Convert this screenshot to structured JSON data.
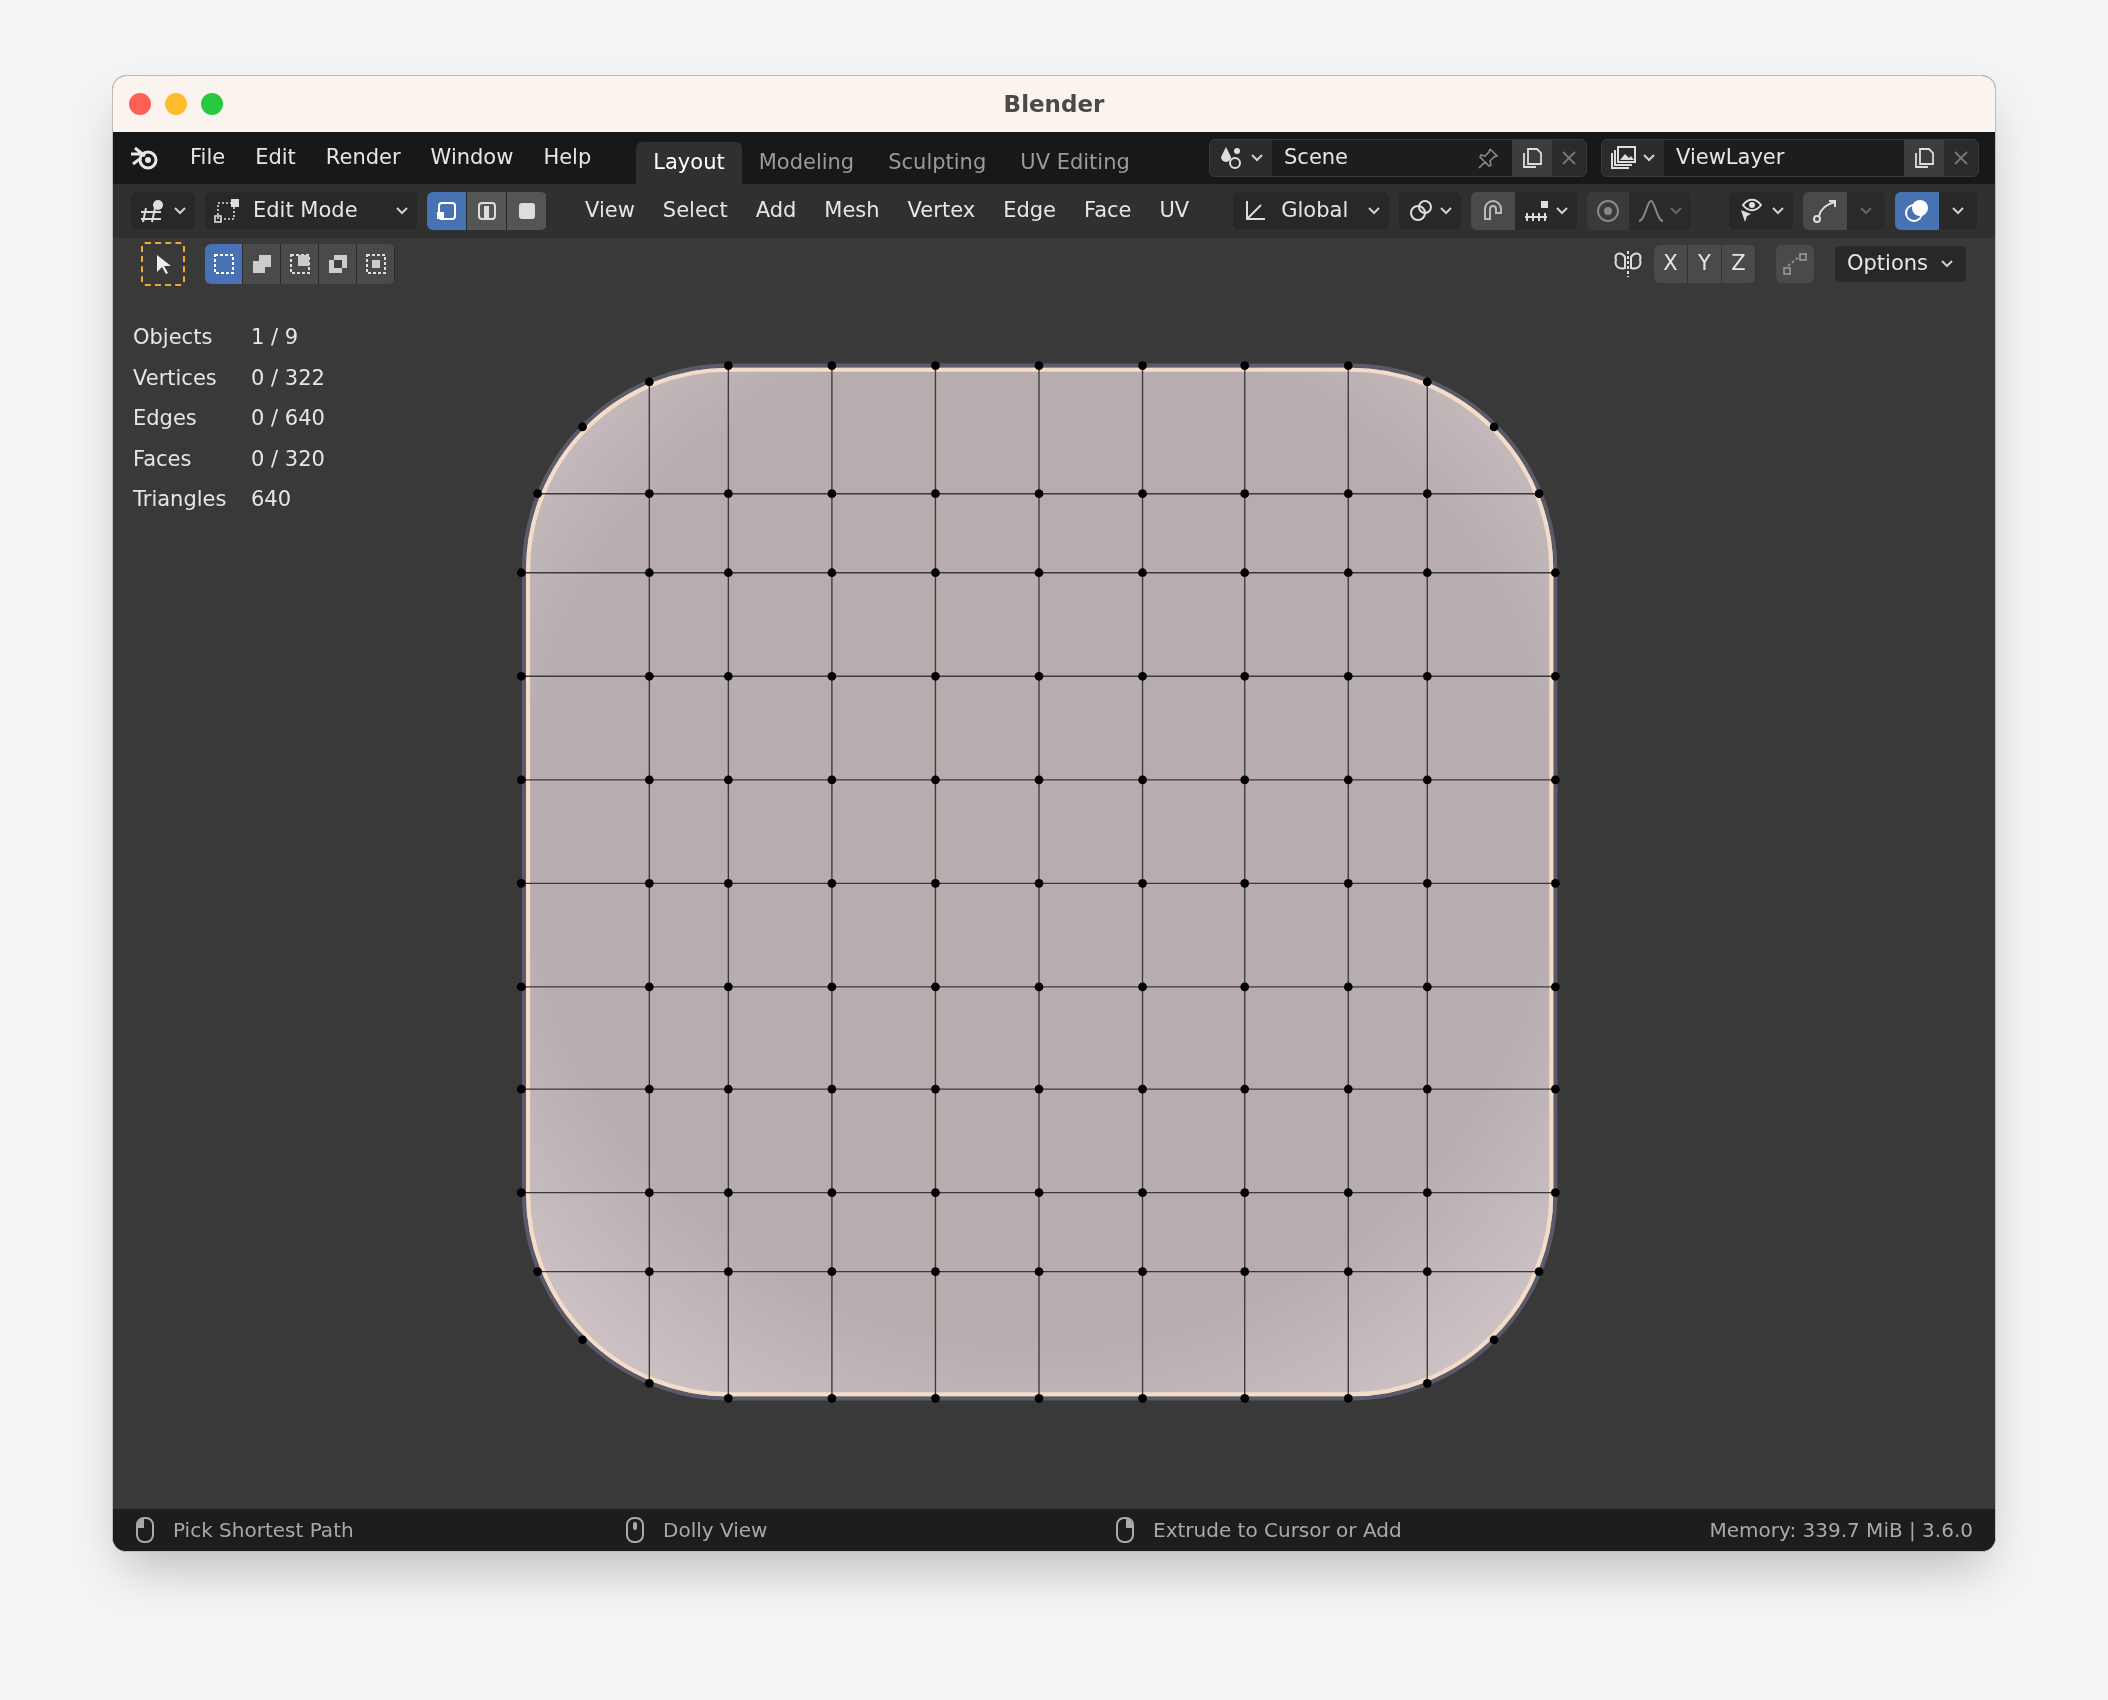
{
  "window": {
    "title": "Blender"
  },
  "menu": [
    "File",
    "Edit",
    "Render",
    "Window",
    "Help"
  ],
  "workspaces": [
    {
      "label": "Layout",
      "selected": true
    },
    {
      "label": "Modeling",
      "selected": false
    },
    {
      "label": "Sculpting",
      "selected": false
    },
    {
      "label": "UV Editing",
      "selected": false
    }
  ],
  "scene": {
    "value": "Scene"
  },
  "view_layer": {
    "value": "ViewLayer"
  },
  "header": {
    "mode": "Edit Mode",
    "select_modes": [
      {
        "kind": "vertex",
        "selected": true
      },
      {
        "kind": "edge",
        "selected": false
      },
      {
        "kind": "face",
        "selected": false
      }
    ],
    "menus": [
      "View",
      "Select",
      "Add",
      "Mesh",
      "Vertex",
      "Edge",
      "Face",
      "UV"
    ],
    "orientation": "Global",
    "snap": {
      "on": false
    },
    "proportional": {
      "on": false
    },
    "xray": {
      "on": true
    }
  },
  "tool_row": {
    "select_tool": {
      "selected": true
    },
    "box_modes": [
      {
        "kind": "new",
        "selected": true
      },
      {
        "kind": "extend",
        "selected": false
      },
      {
        "kind": "subtract",
        "selected": false
      },
      {
        "kind": "invert",
        "selected": false
      },
      {
        "kind": "intersect",
        "selected": false
      }
    ],
    "axes": [
      {
        "label": "X",
        "selected": false
      },
      {
        "label": "Y",
        "selected": false
      },
      {
        "label": "Z",
        "selected": false
      }
    ],
    "options": "Options"
  },
  "stats": [
    {
      "label": "Objects",
      "value": "1 / 9"
    },
    {
      "label": "Vertices",
      "value": "0 / 322"
    },
    {
      "label": "Edges",
      "value": "0 / 640"
    },
    {
      "label": "Faces",
      "value": "0 / 320"
    },
    {
      "label": "Triangles",
      "value": "640"
    }
  ],
  "status_bar": {
    "hints": [
      {
        "kind": "left",
        "text": "Pick Shortest Path"
      },
      {
        "kind": "middle",
        "text": "Dolly View"
      },
      {
        "kind": "right",
        "text": "Extrude to Cursor or Add"
      }
    ],
    "memory": "Memory: 339.7 MiB | 3.6.0"
  }
}
